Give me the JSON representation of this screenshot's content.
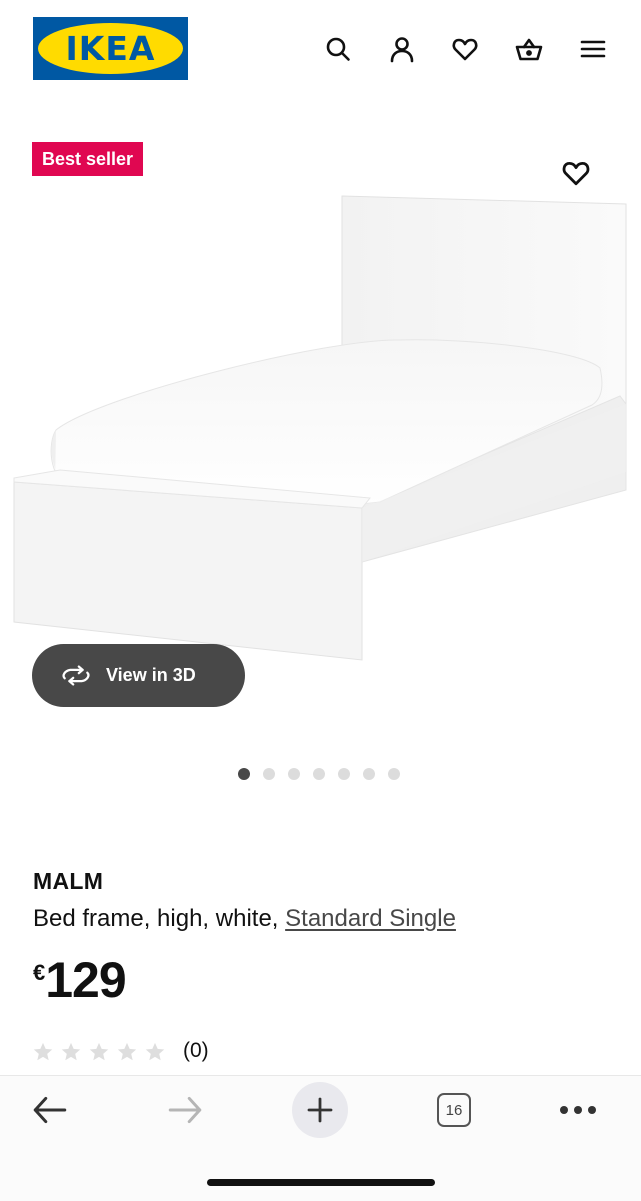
{
  "header": {
    "logo_text": "IKEA",
    "icons": [
      "search-icon",
      "account-icon",
      "heart-icon",
      "basket-icon",
      "menu-icon"
    ],
    "brand_blue": "#0058a3",
    "brand_yellow": "#ffdb00"
  },
  "product_image": {
    "badge": "Best seller",
    "badge_color": "#e00751",
    "view_3d_label": "View in 3D",
    "carousel_total": 7,
    "carousel_active": 1
  },
  "product": {
    "name": "MALM",
    "description": "Bed frame, high, white, ",
    "size_link": "Standard Single",
    "currency": "€",
    "price": "129",
    "rating_stars": 0,
    "review_count": "(0)"
  },
  "browser_toolbar": {
    "tabs_count": "16",
    "icons": [
      "back-icon",
      "forward-icon",
      "new-tab-icon",
      "tabs-icon",
      "more-icon"
    ]
  }
}
